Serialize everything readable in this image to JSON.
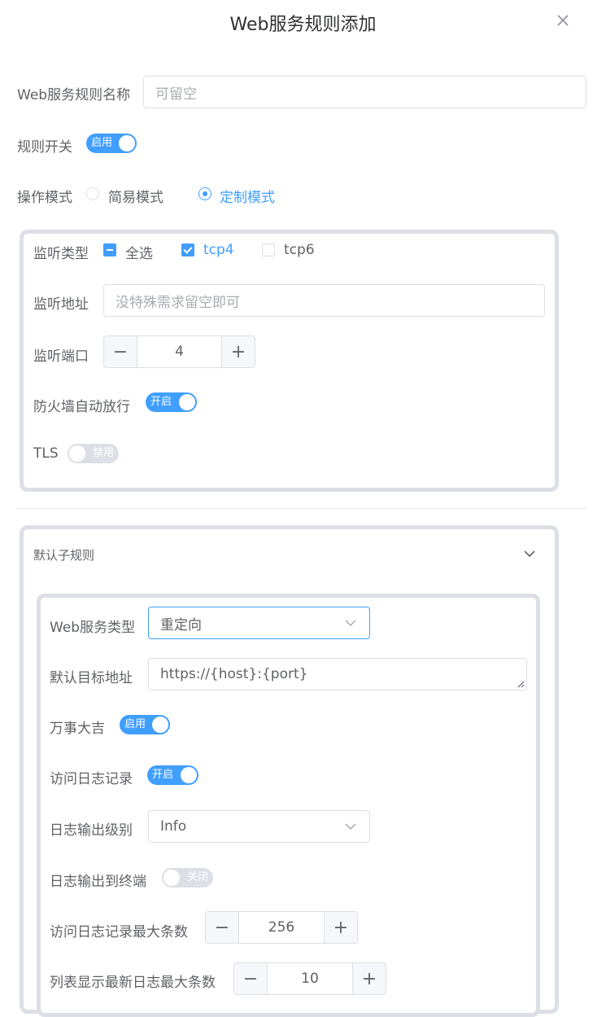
{
  "dialog": {
    "title": "Web服务规则添加",
    "close_icon": "close-icon"
  },
  "form": {
    "name_label": "Web服务规则名称",
    "name_placeholder": "可留空",
    "rule_switch_label": "规则开关",
    "rule_switch_text": "启用",
    "rule_switch_on": true,
    "mode_label": "操作模式",
    "mode_options": [
      "简易模式",
      "定制模式"
    ],
    "mode_selected": "定制模式"
  },
  "listen": {
    "type_label": "监听类型",
    "select_all": "全选",
    "tcp4": "tcp4",
    "tcp6": "tcp6",
    "tcp4_checked": true,
    "tcp6_checked": false,
    "address_label": "监听地址",
    "address_placeholder": "没特殊需求留空即可",
    "port_label": "监听端口",
    "port_value": "4",
    "firewall_label": "防火墙自动放行",
    "firewall_text": "开启",
    "firewall_on": true,
    "tls_label": "TLS",
    "tls_text": "禁用",
    "tls_on": false
  },
  "subrule": {
    "title": "默认子规则",
    "service_type_label": "Web服务类型",
    "service_type_value": "重定向",
    "target_label": "默认目标地址",
    "target_value": "https://{host}:{port}",
    "wanshi_label": "万事大吉",
    "wanshi_text": "启用",
    "wanshi_on": true,
    "access_log_label": "访问日志记录",
    "access_log_text": "开启",
    "access_log_on": true,
    "log_level_label": "日志输出级别",
    "log_level_value": "Info",
    "log_terminal_label": "日志输出到终端",
    "log_terminal_text": "关闭",
    "log_terminal_on": false,
    "max_access_log_label": "访问日志记录最大条数",
    "max_access_log_value": "256",
    "max_list_log_label": "列表显示最新日志最大条数",
    "max_list_log_value": "10"
  },
  "colors": {
    "accent": "#409eff",
    "border": "#dcdfe6",
    "text": "#606266",
    "placeholder": "#a8abb2"
  }
}
